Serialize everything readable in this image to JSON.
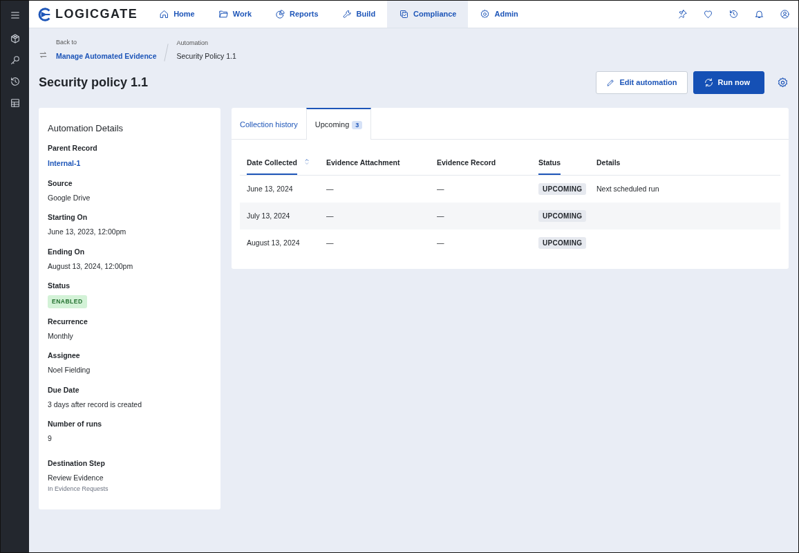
{
  "brand": {
    "name": "LOGICGATE"
  },
  "nav": [
    {
      "label": "Home",
      "selected": false
    },
    {
      "label": "Work",
      "selected": false
    },
    {
      "label": "Reports",
      "selected": false
    },
    {
      "label": "Build",
      "selected": false
    },
    {
      "label": "Compliance",
      "selected": true
    },
    {
      "label": "Admin",
      "selected": false
    }
  ],
  "breadcrumb": {
    "back_label": "Back to",
    "back_link": "Manage Automated Evidence",
    "section": "Automation",
    "current": "Security Policy 1.1"
  },
  "page_title": "Security policy 1.1",
  "actions": [
    {
      "label": "Edit automation",
      "kind": "outline"
    },
    {
      "label": "Run now",
      "kind": "primary"
    }
  ],
  "details": {
    "title": "Automation Details",
    "fields": [
      {
        "label": "Parent Record",
        "value": "Internal-1",
        "kind": "link"
      },
      {
        "label": "Source",
        "value": "Google Drive",
        "kind": "text"
      },
      {
        "label": "Starting On",
        "value": "June 13, 2023, 12:00pm",
        "kind": "text"
      },
      {
        "label": "Ending On",
        "value": "August 13, 2024, 12:00pm",
        "kind": "text"
      },
      {
        "label": "Status",
        "value": "ENABLED",
        "kind": "badge"
      },
      {
        "label": "Recurrence",
        "value": "Monthly",
        "kind": "text"
      },
      {
        "label": "Assignee",
        "value": "Noel Fielding",
        "kind": "text"
      },
      {
        "label": "Due Date",
        "value": "3 days after record is created",
        "kind": "text"
      },
      {
        "label": "Number of runs",
        "value": "9",
        "kind": "text"
      },
      {
        "label": "Destination Step",
        "value": "Review Evidence",
        "kind": "text",
        "note": "In Evidence Requests"
      }
    ]
  },
  "tabs": [
    {
      "label": "Collection history",
      "selected": false
    },
    {
      "label": "Upcoming",
      "count": "3",
      "selected": true
    }
  ],
  "table": {
    "columns": [
      {
        "label": "Date Collected",
        "active": true,
        "sortable": true
      },
      {
        "label": "Evidence Attachment",
        "active": false,
        "sortable": false
      },
      {
        "label": "Evidence Record",
        "active": false,
        "sortable": false
      },
      {
        "label": "Status",
        "active": true,
        "sortable": false
      },
      {
        "label": "Details",
        "active": false,
        "sortable": false
      }
    ],
    "rows": [
      {
        "cells": [
          "June 13, 2024",
          "—",
          "—",
          "UPCOMING",
          "Next scheduled run"
        ]
      },
      {
        "cells": [
          "July 13, 2024",
          "—",
          "—",
          "UPCOMING"
        ]
      },
      {
        "cells": [
          "August 13, 2024",
          "—",
          "—",
          "UPCOMING"
        ]
      }
    ]
  }
}
